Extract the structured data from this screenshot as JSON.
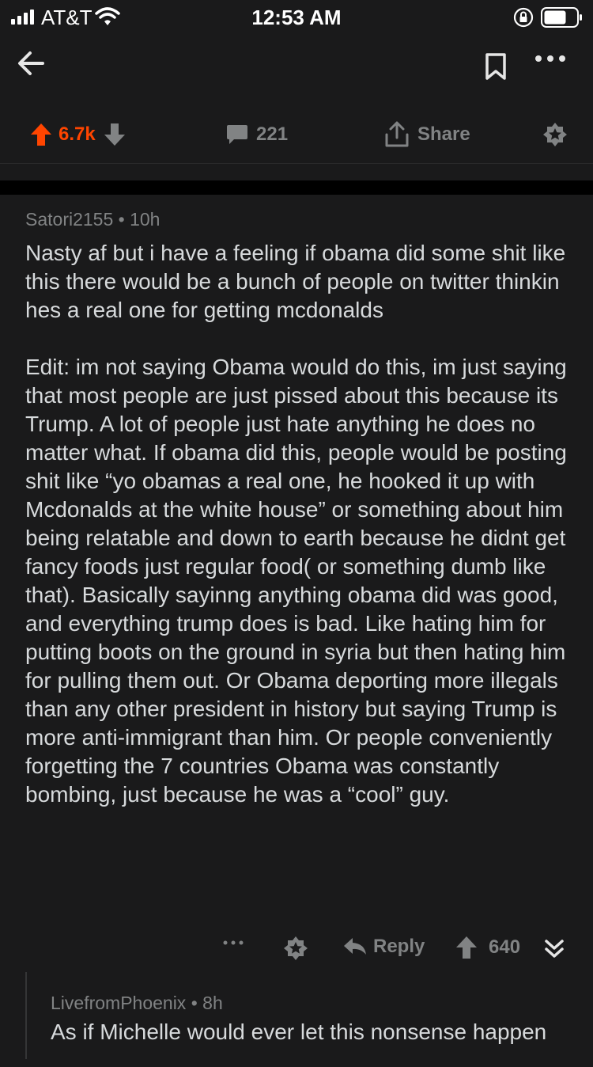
{
  "status": {
    "carrier": "AT&T",
    "time": "12:53 AM"
  },
  "post_actions": {
    "upvotes": "6.7k",
    "comments": "221",
    "share_label": "Share"
  },
  "comment": {
    "author": "Satori2155",
    "age": "10h",
    "paragraph1": "Nasty af but i have a feeling if obama did some shit like this there would be a bunch of people on twitter thinkin hes a real one for getting mcdonalds",
    "paragraph2": "Edit: im not saying Obama would do this, im just saying that most people are just pissed about this because its Trump. A lot of people just hate anything he does no matter what. If obama did this, people would be posting shit like “yo obamas a real one, he hooked it up with Mcdonalds at the white house” or something about him being relatable and down to earth because he didnt get fancy foods just regular food( or something dumb like that). Basically sayinng anything obama did was good, and everything trump does is bad. Like hating him for putting boots on the ground in syria but then hating him for pulling them out. Or Obama deporting more illegals than any other president in history but saying Trump is more anti-immigrant than him. Or people conveniently forgetting the 7 countries Obama was constantly bombing,  just because he was a “cool” guy.",
    "reply_label": "Reply",
    "score": "640"
  },
  "reply": {
    "author": "LivefromPhoenix",
    "age": "8h",
    "text": "As if Michelle would ever let this nonsense happen"
  },
  "colors": {
    "background": "#1a1a1b",
    "upvote_active": "#ff4500",
    "muted": "#818384",
    "text": "#d7dadc"
  },
  "icons": {
    "back": "arrow-left-icon",
    "bookmark": "bookmark-icon",
    "more": "more-horizontal-icon",
    "upvote": "upvote-arrow-icon",
    "downvote": "downvote-arrow-icon",
    "comment": "comment-bubble-icon",
    "share": "share-icon",
    "award": "award-icon",
    "reply": "reply-arrow-icon",
    "collapse": "chevron-double-down-icon"
  }
}
